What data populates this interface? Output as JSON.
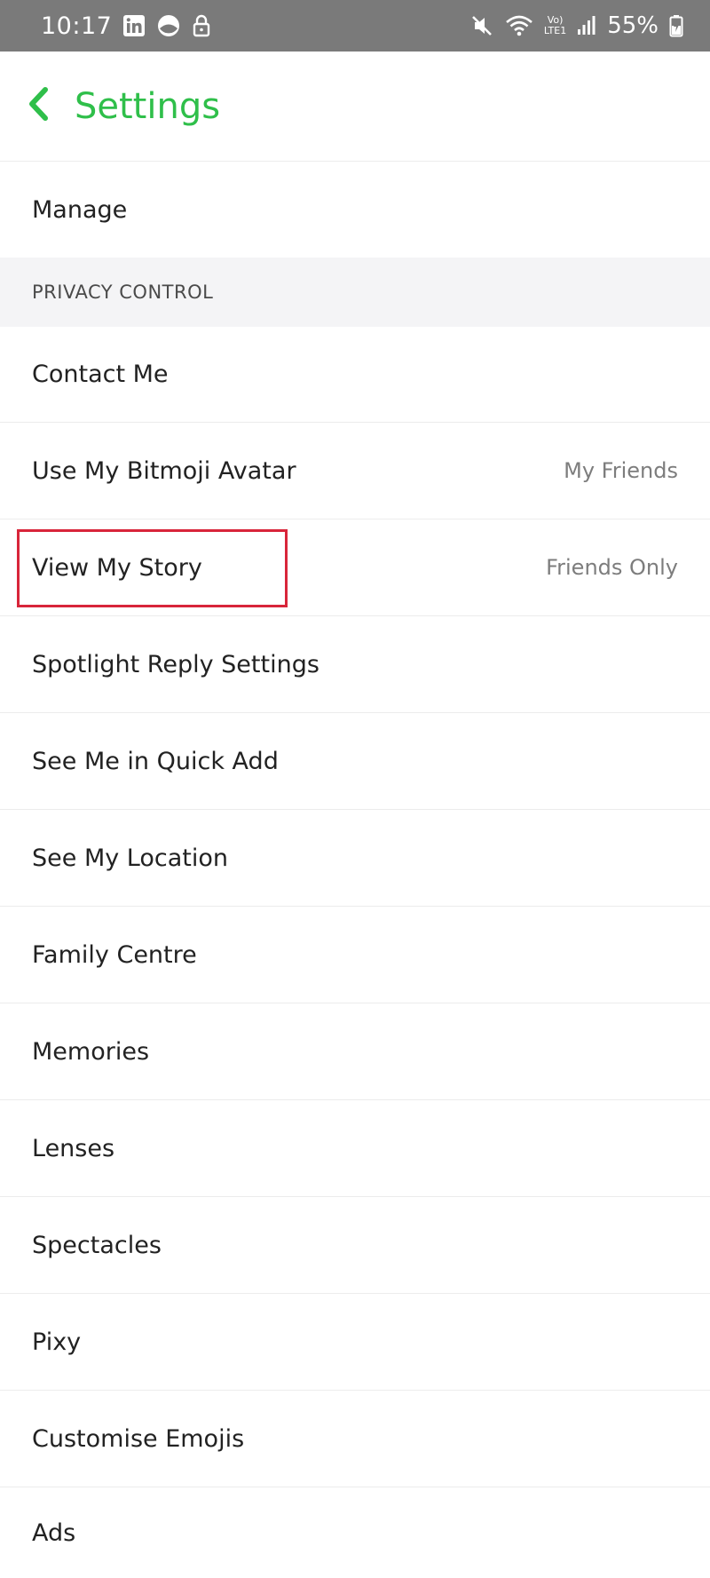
{
  "status_bar": {
    "time": "10:17",
    "battery": "55%",
    "left_icons": [
      "linkedin-icon",
      "app-notification-icon",
      "lock-icon"
    ],
    "right_icons": [
      "mute-icon",
      "wifi-icon",
      "volte-icon",
      "signal-icon",
      "battery-charging-icon"
    ],
    "volte_text": "Vo)",
    "lte_text": "LTE1"
  },
  "header": {
    "title": "Settings",
    "back_icon": "chevron-left-icon",
    "accent_color": "#2fbf4a"
  },
  "rows_top": [
    {
      "label": "Manage"
    }
  ],
  "section": {
    "title": "PRIVACY CONTROL"
  },
  "rows": [
    {
      "label": "Contact Me",
      "value": ""
    },
    {
      "label": "Use My Bitmoji Avatar",
      "value": "My Friends"
    },
    {
      "label": "View My Story",
      "value": "Friends Only"
    },
    {
      "label": "Spotlight Reply Settings",
      "value": ""
    },
    {
      "label": "See Me in Quick Add",
      "value": ""
    },
    {
      "label": "See My Location",
      "value": ""
    },
    {
      "label": "Family Centre",
      "value": ""
    },
    {
      "label": "Memories",
      "value": ""
    },
    {
      "label": "Lenses",
      "value": ""
    },
    {
      "label": "Spectacles",
      "value": ""
    },
    {
      "label": "Pixy",
      "value": ""
    },
    {
      "label": "Customise Emojis",
      "value": ""
    },
    {
      "label": "Ads",
      "value": ""
    }
  ],
  "annotation": {
    "highlight_color": "#d8253a"
  }
}
